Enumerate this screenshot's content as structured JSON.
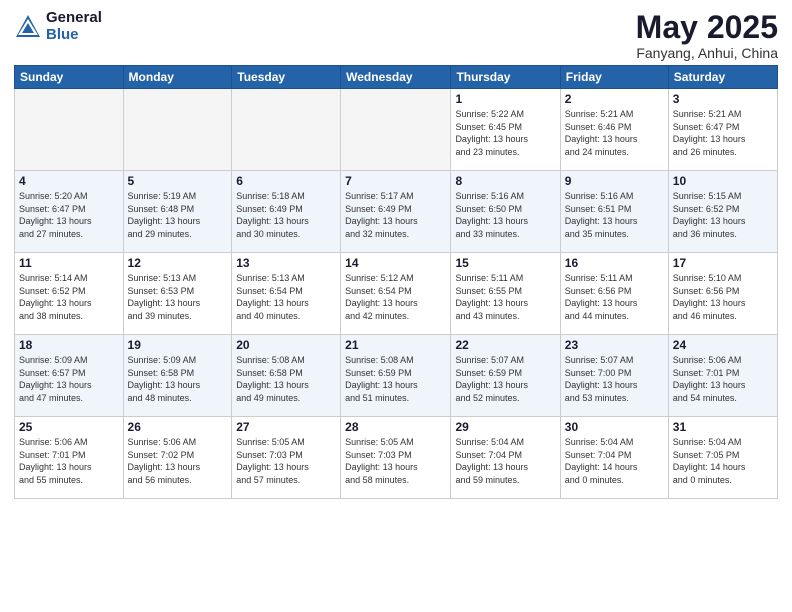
{
  "header": {
    "logo_general": "General",
    "logo_blue": "Blue",
    "month_year": "May 2025",
    "location": "Fanyang, Anhui, China"
  },
  "days_of_week": [
    "Sunday",
    "Monday",
    "Tuesday",
    "Wednesday",
    "Thursday",
    "Friday",
    "Saturday"
  ],
  "weeks": [
    [
      {
        "num": "",
        "info": ""
      },
      {
        "num": "",
        "info": ""
      },
      {
        "num": "",
        "info": ""
      },
      {
        "num": "",
        "info": ""
      },
      {
        "num": "1",
        "info": "Sunrise: 5:22 AM\nSunset: 6:45 PM\nDaylight: 13 hours\nand 23 minutes."
      },
      {
        "num": "2",
        "info": "Sunrise: 5:21 AM\nSunset: 6:46 PM\nDaylight: 13 hours\nand 24 minutes."
      },
      {
        "num": "3",
        "info": "Sunrise: 5:21 AM\nSunset: 6:47 PM\nDaylight: 13 hours\nand 26 minutes."
      }
    ],
    [
      {
        "num": "4",
        "info": "Sunrise: 5:20 AM\nSunset: 6:47 PM\nDaylight: 13 hours\nand 27 minutes."
      },
      {
        "num": "5",
        "info": "Sunrise: 5:19 AM\nSunset: 6:48 PM\nDaylight: 13 hours\nand 29 minutes."
      },
      {
        "num": "6",
        "info": "Sunrise: 5:18 AM\nSunset: 6:49 PM\nDaylight: 13 hours\nand 30 minutes."
      },
      {
        "num": "7",
        "info": "Sunrise: 5:17 AM\nSunset: 6:49 PM\nDaylight: 13 hours\nand 32 minutes."
      },
      {
        "num": "8",
        "info": "Sunrise: 5:16 AM\nSunset: 6:50 PM\nDaylight: 13 hours\nand 33 minutes."
      },
      {
        "num": "9",
        "info": "Sunrise: 5:16 AM\nSunset: 6:51 PM\nDaylight: 13 hours\nand 35 minutes."
      },
      {
        "num": "10",
        "info": "Sunrise: 5:15 AM\nSunset: 6:52 PM\nDaylight: 13 hours\nand 36 minutes."
      }
    ],
    [
      {
        "num": "11",
        "info": "Sunrise: 5:14 AM\nSunset: 6:52 PM\nDaylight: 13 hours\nand 38 minutes."
      },
      {
        "num": "12",
        "info": "Sunrise: 5:13 AM\nSunset: 6:53 PM\nDaylight: 13 hours\nand 39 minutes."
      },
      {
        "num": "13",
        "info": "Sunrise: 5:13 AM\nSunset: 6:54 PM\nDaylight: 13 hours\nand 40 minutes."
      },
      {
        "num": "14",
        "info": "Sunrise: 5:12 AM\nSunset: 6:54 PM\nDaylight: 13 hours\nand 42 minutes."
      },
      {
        "num": "15",
        "info": "Sunrise: 5:11 AM\nSunset: 6:55 PM\nDaylight: 13 hours\nand 43 minutes."
      },
      {
        "num": "16",
        "info": "Sunrise: 5:11 AM\nSunset: 6:56 PM\nDaylight: 13 hours\nand 44 minutes."
      },
      {
        "num": "17",
        "info": "Sunrise: 5:10 AM\nSunset: 6:56 PM\nDaylight: 13 hours\nand 46 minutes."
      }
    ],
    [
      {
        "num": "18",
        "info": "Sunrise: 5:09 AM\nSunset: 6:57 PM\nDaylight: 13 hours\nand 47 minutes."
      },
      {
        "num": "19",
        "info": "Sunrise: 5:09 AM\nSunset: 6:58 PM\nDaylight: 13 hours\nand 48 minutes."
      },
      {
        "num": "20",
        "info": "Sunrise: 5:08 AM\nSunset: 6:58 PM\nDaylight: 13 hours\nand 49 minutes."
      },
      {
        "num": "21",
        "info": "Sunrise: 5:08 AM\nSunset: 6:59 PM\nDaylight: 13 hours\nand 51 minutes."
      },
      {
        "num": "22",
        "info": "Sunrise: 5:07 AM\nSunset: 6:59 PM\nDaylight: 13 hours\nand 52 minutes."
      },
      {
        "num": "23",
        "info": "Sunrise: 5:07 AM\nSunset: 7:00 PM\nDaylight: 13 hours\nand 53 minutes."
      },
      {
        "num": "24",
        "info": "Sunrise: 5:06 AM\nSunset: 7:01 PM\nDaylight: 13 hours\nand 54 minutes."
      }
    ],
    [
      {
        "num": "25",
        "info": "Sunrise: 5:06 AM\nSunset: 7:01 PM\nDaylight: 13 hours\nand 55 minutes."
      },
      {
        "num": "26",
        "info": "Sunrise: 5:06 AM\nSunset: 7:02 PM\nDaylight: 13 hours\nand 56 minutes."
      },
      {
        "num": "27",
        "info": "Sunrise: 5:05 AM\nSunset: 7:03 PM\nDaylight: 13 hours\nand 57 minutes."
      },
      {
        "num": "28",
        "info": "Sunrise: 5:05 AM\nSunset: 7:03 PM\nDaylight: 13 hours\nand 58 minutes."
      },
      {
        "num": "29",
        "info": "Sunrise: 5:04 AM\nSunset: 7:04 PM\nDaylight: 13 hours\nand 59 minutes."
      },
      {
        "num": "30",
        "info": "Sunrise: 5:04 AM\nSunset: 7:04 PM\nDaylight: 14 hours\nand 0 minutes."
      },
      {
        "num": "31",
        "info": "Sunrise: 5:04 AM\nSunset: 7:05 PM\nDaylight: 14 hours\nand 0 minutes."
      }
    ]
  ]
}
